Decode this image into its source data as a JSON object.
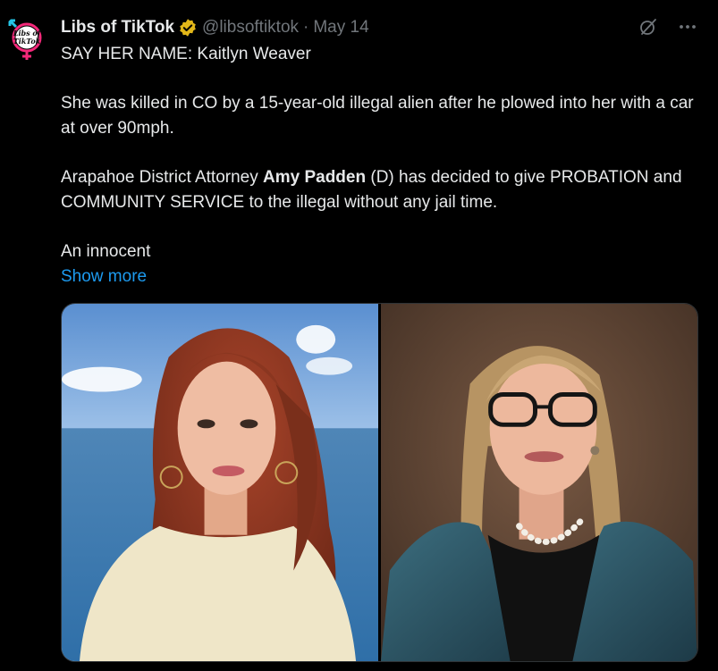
{
  "tweet": {
    "display_name": "Libs of TikTok",
    "handle": "@libsoftiktok",
    "separator": "·",
    "date": "May 14",
    "avatar_text_line1": "Libs of",
    "avatar_text_line2": "TikTok",
    "line1": "SAY HER NAME: Kaitlyn Weaver",
    "para2": "She was killed in CO by a 15-year-old illegal alien after he plowed into her with a car at over 90mph.",
    "para3_before": "Arapahoe District Attorney ",
    "para3_bold": "Amy Padden",
    "para3_after": " (D) has decided to give PROBATION and COMMUNITY SERVICE to the illegal without any jail time.",
    "para4": "An innocent",
    "show_more": "Show more"
  },
  "icons": {
    "verified": "verified-badge-icon",
    "grok": "grok-icon",
    "more": "more-icon"
  },
  "colors": {
    "background": "#000000",
    "text": "#e7e9ea",
    "secondary": "#71767b",
    "link": "#1d9bf0",
    "verified_gold": "#e2b719",
    "avatar_pink": "#f4297a",
    "avatar_cyan": "#25c5e6"
  }
}
